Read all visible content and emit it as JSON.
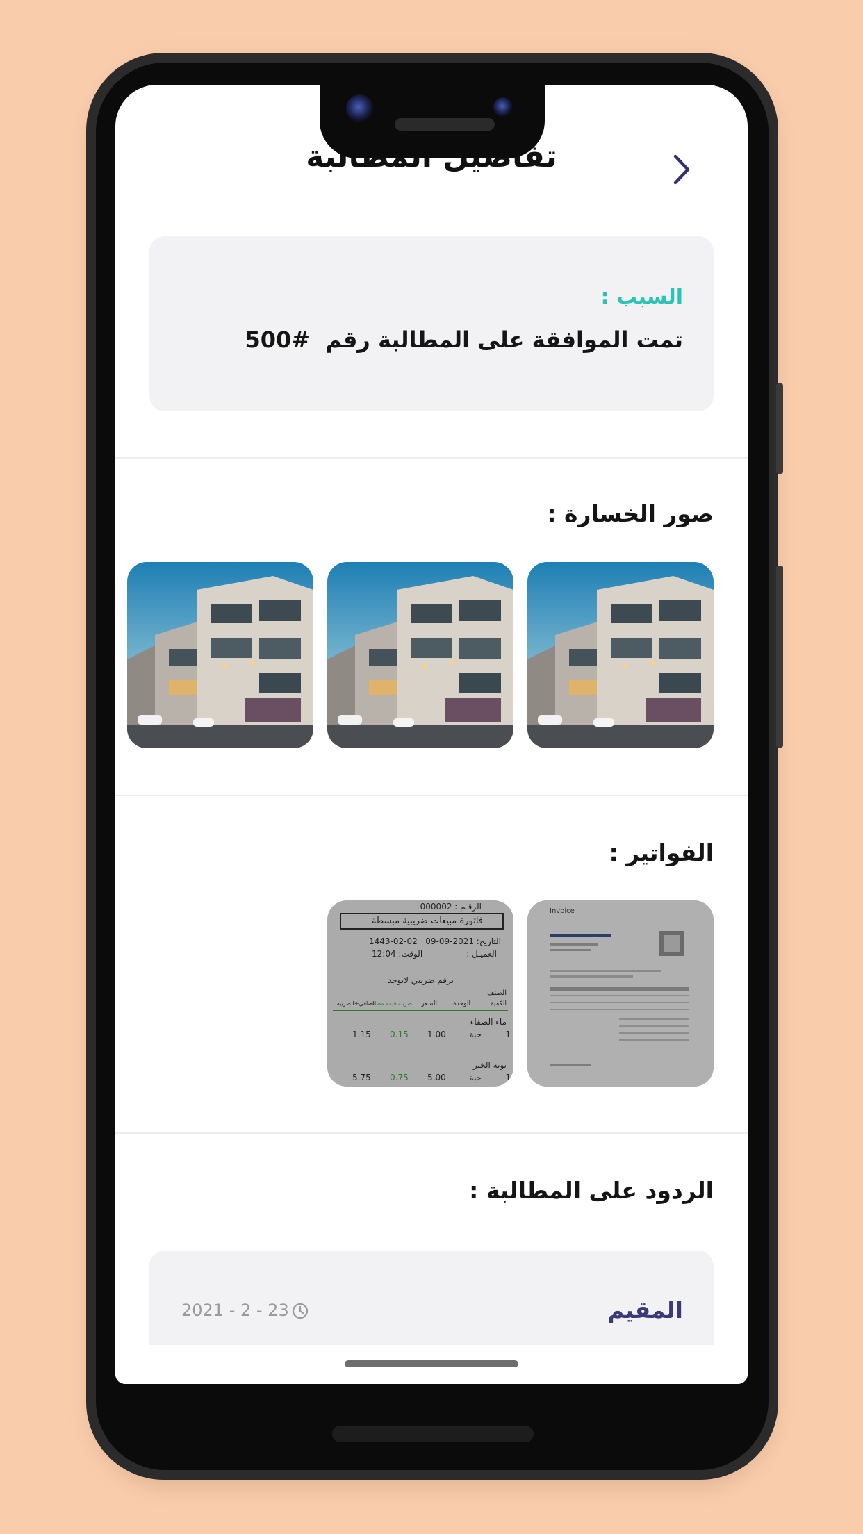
{
  "header": {
    "title": "تفاصيل المطالبة",
    "back_icon": "chevron-right-icon"
  },
  "reason": {
    "label": "السبب :",
    "text": "تمت الموافقة على المطالبة رقم  #500"
  },
  "loss_photos": {
    "title": "صور الخسارة :",
    "count": 3
  },
  "invoices": {
    "title": "الفواتير :",
    "receipt": {
      "number": "الرقـم : 000002",
      "heading": "فاتورة مبيعات ضريبية مبسطة",
      "date_label": "التاريخ: 2021-09-09",
      "hijri_date": "1443-02-02",
      "customer_label": "العميـل :",
      "time_label": "الوقت: 12:04",
      "tax_number": "برقم ضريبي  لايوجد",
      "category": "الصنف",
      "columns": [
        "الكمية",
        "الوحدة",
        "السعر",
        "ضريبة قيمة مضافة",
        "الصافي+الضريبة"
      ],
      "rows": [
        {
          "name": "ماء الصفاء",
          "qty": "1",
          "unit": "حبة",
          "price": "1.00",
          "vat": "0.15",
          "total": "1.15"
        },
        {
          "name": "تونة الخير",
          "qty": "1",
          "unit": "حبة",
          "price": "5.00",
          "vat": "0.75",
          "total": "5.75"
        }
      ]
    },
    "document": {
      "heading": "Invoice"
    }
  },
  "replies": {
    "title": "الردود على المطالبة :",
    "items": [
      {
        "author": "المقيم",
        "date": "2021 - 2 - 23"
      }
    ]
  },
  "colors": {
    "accent_teal": "#2bc4b4",
    "author_purple": "#3b3a78",
    "card_bg": "#f2f2f4",
    "background": "#f9cdac"
  }
}
